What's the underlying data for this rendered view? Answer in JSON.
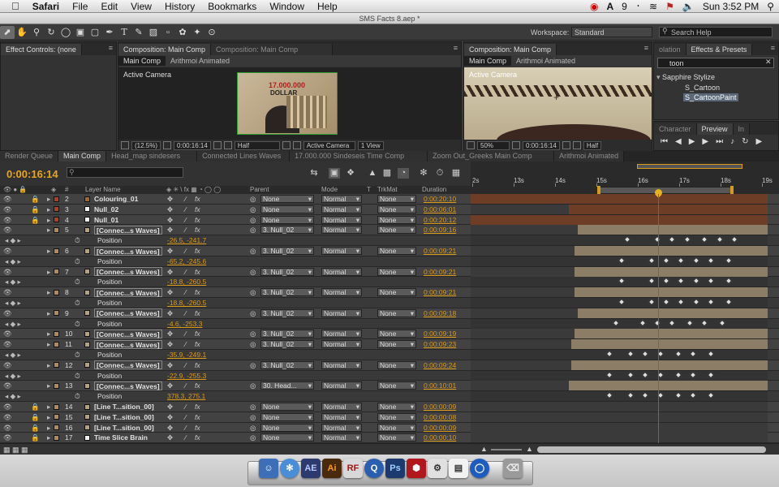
{
  "menubar": {
    "apple": "",
    "items": [
      "Safari",
      "File",
      "Edit",
      "View",
      "History",
      "Bookmarks",
      "Window",
      "Help"
    ],
    "right": {
      "badge": "9",
      "clock": "Sun 3:52 PM"
    }
  },
  "window": {
    "title": "SMS Facts 8.aep *"
  },
  "toolbar": {
    "workspace_label": "Workspace:",
    "workspace_value": "Standard",
    "search_placeholder": "Search Help"
  },
  "panels": {
    "effect_controls_tab": "Effect Controls: (none",
    "comp1": {
      "tab": "Composition: Main Comp",
      "tab2": "Composition: Main Comp",
      "subtabs": [
        "Main Comp",
        "Arithmoi Animated"
      ],
      "camera": "Active Camera",
      "zoom": "(12.5%)",
      "timecode": "0:00:16:14",
      "resolution": "Half",
      "view": "Active Camera",
      "views": "1 View",
      "image_text_top": "17.000.000",
      "image_text_bot": "DOLLAR"
    },
    "comp2": {
      "tab": "Composition: Main Comp",
      "subtabs": [
        "Main Comp",
        "Arithmoi Animated"
      ],
      "camera": "Active Camera",
      "zoom": "50%",
      "timecode": "0:00:16:14",
      "resolution": "Half"
    },
    "effects": {
      "tab_prev": "olation",
      "tab": "Effects & Presets",
      "search": "toon",
      "group": "Sapphire Stylize",
      "items": [
        "S_Cartoon",
        "S_CartoonPaint"
      ]
    },
    "preview": {
      "tabs": [
        "Character",
        "Preview",
        "In"
      ]
    }
  },
  "timeline": {
    "tabs": [
      "Render Queue",
      "Main Comp",
      "Head_map sindesers",
      "Connected Lines Waves",
      "17.000.000 Sindeseis Time Comp",
      "Zoom Out_Greeks Main Comp",
      "Arithmoi Animated"
    ],
    "timecode": "0:00:16:14",
    "columns": {
      "num": "#",
      "layer_name": "Layer Name",
      "parent": "Parent",
      "mode": "Mode",
      "t": "T",
      "trkmat": "TrkMat",
      "duration": "Duration"
    },
    "ruler": [
      "2s",
      "13s",
      "14s",
      "15s",
      "16s",
      "17s",
      "18s",
      "19s"
    ],
    "rows": [
      {
        "kind": "layer",
        "num": "2",
        "name": "Colouring_01",
        "color": "#a06a36",
        "parent": "None",
        "mode": "Normal",
        "trk": "None",
        "dur": "0:00:20:10",
        "lock": true,
        "bar": {
          "s": 0.0,
          "e": 1.0,
          "c": "#6e3d25"
        }
      },
      {
        "kind": "layer",
        "num": "3",
        "name": "Null_02",
        "color": "#f0f0f0",
        "parent": "None",
        "mode": "Normal",
        "trk": "None",
        "dur": "0:00:06:01",
        "lock": true,
        "bar": {
          "s": 0.33,
          "e": 1.0,
          "c": "#6e3d25"
        }
      },
      {
        "kind": "layer",
        "num": "4",
        "name": "Null_01",
        "color": "#f0f0f0",
        "parent": "None",
        "mode": "Normal",
        "trk": "None",
        "dur": "0:00:20:12",
        "lock": true,
        "bar": {
          "s": 0.0,
          "e": 1.0,
          "c": "#6e3d25"
        }
      },
      {
        "kind": "layer",
        "num": "5",
        "name": "[Connec...s Waves]",
        "box": true,
        "color": "#b5a080",
        "parent": "3. Null_02",
        "mode": "Normal",
        "trk": "None",
        "dur": "0:00:09:16",
        "bar": {
          "s": 0.36,
          "e": 1.0,
          "c": "#8c7d66"
        }
      },
      {
        "kind": "prop",
        "name": "Position",
        "value": "-26.5, -241.7",
        "kf": [
          0.52,
          0.62,
          0.67,
          0.72,
          0.78,
          0.83,
          0.88
        ]
      },
      {
        "kind": "layer",
        "num": "6",
        "name": "[Connec...s Waves]",
        "box": true,
        "color": "#b5a080",
        "parent": "3. Null_02",
        "mode": "Normal",
        "trk": "None",
        "dur": "0:00:09:21",
        "bar": {
          "s": 0.35,
          "e": 1.0,
          "c": "#8c7d66"
        }
      },
      {
        "kind": "prop",
        "name": "Position",
        "value": "-65.2, -245.6",
        "kf": [
          0.5,
          0.6,
          0.65,
          0.7,
          0.75,
          0.8,
          0.86
        ]
      },
      {
        "kind": "layer",
        "num": "7",
        "name": "[Connec...s Waves]",
        "box": true,
        "color": "#b5a080",
        "parent": "3. Null_02",
        "mode": "Normal",
        "trk": "None",
        "dur": "0:00:09:21",
        "bar": {
          "s": 0.35,
          "e": 1.0,
          "c": "#8c7d66"
        }
      },
      {
        "kind": "prop",
        "name": "Position",
        "value": "-18.8, -260.5",
        "kf": [
          0.5,
          0.6,
          0.65,
          0.7,
          0.75,
          0.8,
          0.86
        ]
      },
      {
        "kind": "layer",
        "num": "8",
        "name": "[Connec...s Waves]",
        "box": true,
        "color": "#b5a080",
        "parent": "3. Null_02",
        "mode": "Normal",
        "trk": "None",
        "dur": "0:00:09:21",
        "bar": {
          "s": 0.35,
          "e": 1.0,
          "c": "#8c7d66"
        }
      },
      {
        "kind": "prop",
        "name": "Position",
        "value": "-18.8, -260.5",
        "kf": [
          0.5,
          0.6,
          0.65,
          0.7,
          0.75,
          0.8,
          0.86
        ]
      },
      {
        "kind": "layer",
        "num": "9",
        "name": "[Connec...s Waves]",
        "box": true,
        "color": "#b5a080",
        "parent": "3. Null_02",
        "mode": "Normal",
        "trk": "None",
        "dur": "0:00:09:18",
        "bar": {
          "s": 0.36,
          "e": 1.0,
          "c": "#8c7d66"
        }
      },
      {
        "kind": "prop",
        "name": "Position",
        "value": "-4.6, -253.3",
        "kf": [
          0.48,
          0.57,
          0.62,
          0.67,
          0.73,
          0.78,
          0.84
        ]
      },
      {
        "kind": "layer",
        "num": "10",
        "name": "[Connec...s Waves]",
        "box": true,
        "color": "#b5a080",
        "parent": "3. Null_02",
        "mode": "Normal",
        "trk": "None",
        "dur": "0:00:09:19",
        "bar": {
          "s": 0.35,
          "e": 1.0,
          "c": "#8c7d66"
        }
      },
      {
        "kind": "layer",
        "num": "11",
        "name": "[Connec...s Waves]",
        "box": true,
        "color": "#b5a080",
        "parent": "3. Null_02",
        "mode": "Normal",
        "trk": "None",
        "dur": "0:00:09:23",
        "bar": {
          "s": 0.34,
          "e": 1.0,
          "c": "#8c7d66"
        }
      },
      {
        "kind": "prop",
        "name": "Position",
        "value": "-35.9, -249.1",
        "kf": [
          0.46,
          0.53,
          0.58,
          0.63,
          0.69,
          0.74,
          0.8
        ]
      },
      {
        "kind": "layer",
        "num": "12",
        "name": "[Connec...s Waves]",
        "box": true,
        "color": "#b5a080",
        "parent": "3. Null_02",
        "mode": "Normal",
        "trk": "None",
        "dur": "0:00:09:24",
        "bar": {
          "s": 0.34,
          "e": 1.0,
          "c": "#8c7d66"
        }
      },
      {
        "kind": "prop",
        "name": "Position",
        "value": "-22.9, -255.3",
        "kf": [
          0.46,
          0.53,
          0.58,
          0.63,
          0.69,
          0.74,
          0.8
        ]
      },
      {
        "kind": "layer",
        "num": "13",
        "name": "[Connec...s Waves]",
        "box": true,
        "color": "#b5a080",
        "parent": "30. Head...",
        "mode": "Normal",
        "trk": "None",
        "dur": "0:00:10:01",
        "bar": {
          "s": 0.33,
          "e": 1.0,
          "c": "#8c7d66"
        }
      },
      {
        "kind": "prop",
        "name": "Position",
        "value": "378.3, 275.1",
        "kf": [
          0.46,
          0.53,
          0.58,
          0.63,
          0.69,
          0.74,
          0.8
        ]
      },
      {
        "kind": "layer",
        "num": "14",
        "name": "[Line T...sition_00]",
        "box": false,
        "color": "#b5a080",
        "parent": "None",
        "mode": "Normal",
        "trk": "None",
        "dur": "0:00:00:09",
        "lock": true,
        "bar": null
      },
      {
        "kind": "layer",
        "num": "15",
        "name": "[Line T...sition_00]",
        "box": false,
        "color": "#b5a080",
        "parent": "None",
        "mode": "Normal",
        "trk": "None",
        "dur": "0:00:00:08",
        "lock": true,
        "bar": null
      },
      {
        "kind": "layer",
        "num": "16",
        "name": "[Line T...sition_00]",
        "box": false,
        "color": "#b5a080",
        "parent": "None",
        "mode": "Normal",
        "trk": "None",
        "dur": "0:00:00:09",
        "lock": true,
        "bar": null
      },
      {
        "kind": "layer",
        "num": "17",
        "name": "Time Slice Brain",
        "color": "#f0f0f0",
        "parent": "None",
        "mode": "Normal",
        "trk": "None",
        "dur": "0:00:00:10",
        "lock": true,
        "bar": null
      }
    ]
  },
  "dock": {
    "items": [
      "Finder",
      "Safari",
      "AE",
      "Ai",
      "RF",
      "QuickTime",
      "Ps",
      "Cube",
      "Utility",
      "Preview",
      "Earth",
      "Trash"
    ]
  }
}
